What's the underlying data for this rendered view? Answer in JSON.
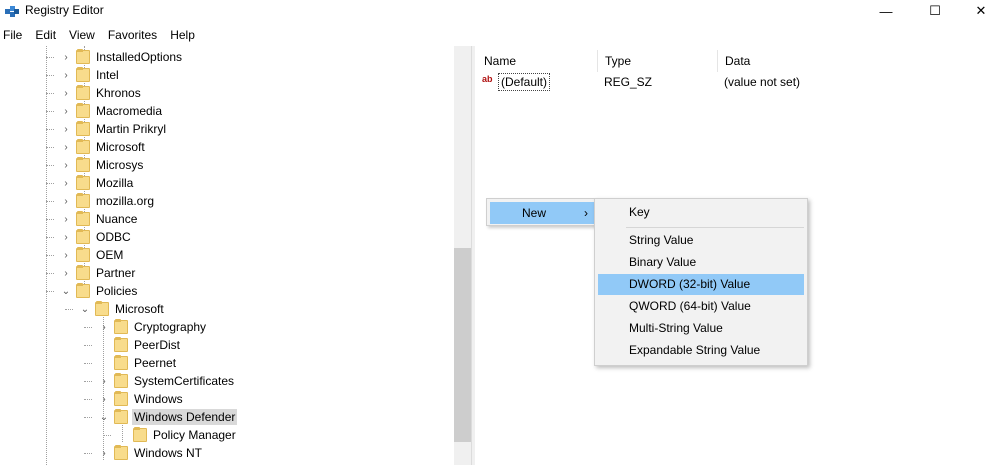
{
  "window": {
    "title": "Registry Editor",
    "minimize": "—",
    "maximize": "☐",
    "close": "✕"
  },
  "menubar": {
    "items": [
      "File",
      "Edit",
      "View",
      "Favorites",
      "Help"
    ]
  },
  "tree": {
    "items": [
      {
        "label": "InstalledOptions",
        "arrow": "›"
      },
      {
        "label": "Intel",
        "arrow": "›"
      },
      {
        "label": "Khronos",
        "arrow": "›"
      },
      {
        "label": "Macromedia",
        "arrow": "›"
      },
      {
        "label": "Martin Prikryl",
        "arrow": "›"
      },
      {
        "label": "Microsoft",
        "arrow": "›"
      },
      {
        "label": "Microsys",
        "arrow": "›"
      },
      {
        "label": "Mozilla",
        "arrow": "›"
      },
      {
        "label": "mozilla.org",
        "arrow": "›"
      },
      {
        "label": "Nuance",
        "arrow": "›"
      },
      {
        "label": "ODBC",
        "arrow": "›"
      },
      {
        "label": "OEM",
        "arrow": "›"
      },
      {
        "label": "Partner",
        "arrow": "›"
      },
      {
        "label": "Policies",
        "arrow": "⌄"
      },
      {
        "label": "Microsoft",
        "arrow": "⌄"
      },
      {
        "label": "Cryptography",
        "arrow": "›"
      },
      {
        "label": "PeerDist",
        "arrow": ""
      },
      {
        "label": "Peernet",
        "arrow": ""
      },
      {
        "label": "SystemCertificates",
        "arrow": "›"
      },
      {
        "label": "Windows",
        "arrow": "›"
      },
      {
        "label": "Windows Defender",
        "arrow": "⌄"
      },
      {
        "label": "Policy Manager",
        "arrow": ""
      },
      {
        "label": "Windows NT",
        "arrow": "›"
      }
    ]
  },
  "list": {
    "columns": [
      "Name",
      "Type",
      "Data"
    ],
    "rows": [
      {
        "icon": "ab",
        "name": "(Default)",
        "type": "REG_SZ",
        "data": "(value not set)"
      }
    ]
  },
  "context_menu": {
    "new_label": "New",
    "new_arrow": "›",
    "submenu": [
      "Key",
      "String Value",
      "Binary Value",
      "DWORD (32-bit) Value",
      "QWORD (64-bit) Value",
      "Multi-String Value",
      "Expandable String Value"
    ],
    "highlighted": "DWORD (32-bit) Value"
  },
  "colors": {
    "highlight": "#91c9f7",
    "folder": "#f8dc8c",
    "selected_tree": "#d9d9d9"
  }
}
